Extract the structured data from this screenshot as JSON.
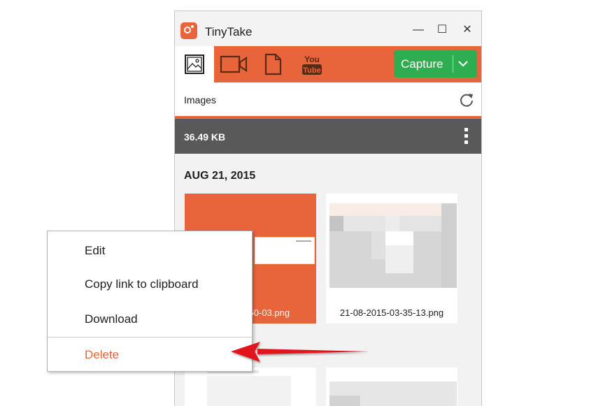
{
  "window": {
    "title": "TinyTake",
    "minimize": "—",
    "maximize": "☐",
    "close": "✕"
  },
  "toolbar": {
    "capture_label": "Capture"
  },
  "section": {
    "title": "Images"
  },
  "storage": {
    "size": "36.49 KB"
  },
  "gallery": {
    "date": "AUG 21, 2015",
    "items": [
      {
        "filename": "3-50-03.png"
      },
      {
        "filename": "21-08-2015-03-35-13.png"
      }
    ]
  },
  "context_menu": {
    "items": [
      {
        "label": "Edit"
      },
      {
        "label": "Copy link to clipboard"
      },
      {
        "label": "Download"
      },
      {
        "label": "Delete"
      }
    ]
  },
  "colors": {
    "accent": "#e8643a",
    "capture": "#2eae50",
    "size_bar": "#595959",
    "annotation_arrow": "#e0151a"
  },
  "icons": [
    "app-logo-icon",
    "image-icon",
    "video-camera-icon",
    "document-icon",
    "youtube-icon",
    "chevron-down-icon",
    "refresh-icon",
    "kebab-menu-icon"
  ]
}
